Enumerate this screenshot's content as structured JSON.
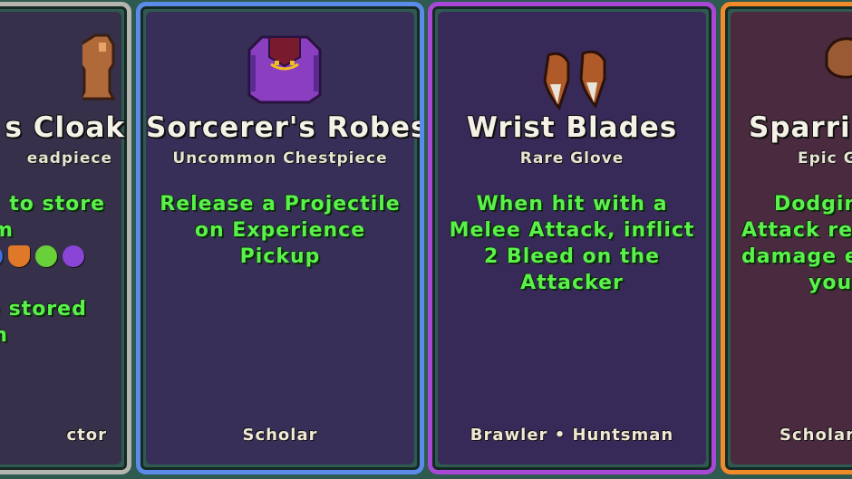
{
  "cards": [
    {
      "title": "s Cloak",
      "subtitle": "eadpiece",
      "desc_lines": [
        "to store",
        "m",
        "e stored",
        "m"
      ],
      "footer": "ctor",
      "border_color": "#b5b5b0",
      "icon": "cloak-icon",
      "gem_icons": [
        "blue-gem-icon",
        "shield-gem-icon",
        "green-gem-icon",
        "purple-gem-icon"
      ]
    },
    {
      "title": "Sorcerer's Robes",
      "subtitle": "Uncommon Chestpiece",
      "desc_lines": [
        "Release a Projectile",
        "on Experience Pickup"
      ],
      "footer": "Scholar",
      "border_color": "#5a8be8",
      "icon": "robes-icon"
    },
    {
      "title": "Wrist Blades",
      "subtitle": "Rare Glove",
      "desc_lines": [
        "When hit with a",
        "Melee Attack, inflict",
        "2 Bleed on the",
        "Attacker"
      ],
      "footer": "Brawler • Huntsman",
      "border_color": "#a948d6",
      "icon": "wrist-blades-icon"
    },
    {
      "title": "Sparrin",
      "subtitle": "Epic G",
      "desc_lines": [
        "Dodging",
        "Attack re",
        "damage e",
        "your"
      ],
      "footer": "Scholar",
      "border_color": "#f08a2a",
      "icon": "sparring-gloves-icon"
    }
  ]
}
